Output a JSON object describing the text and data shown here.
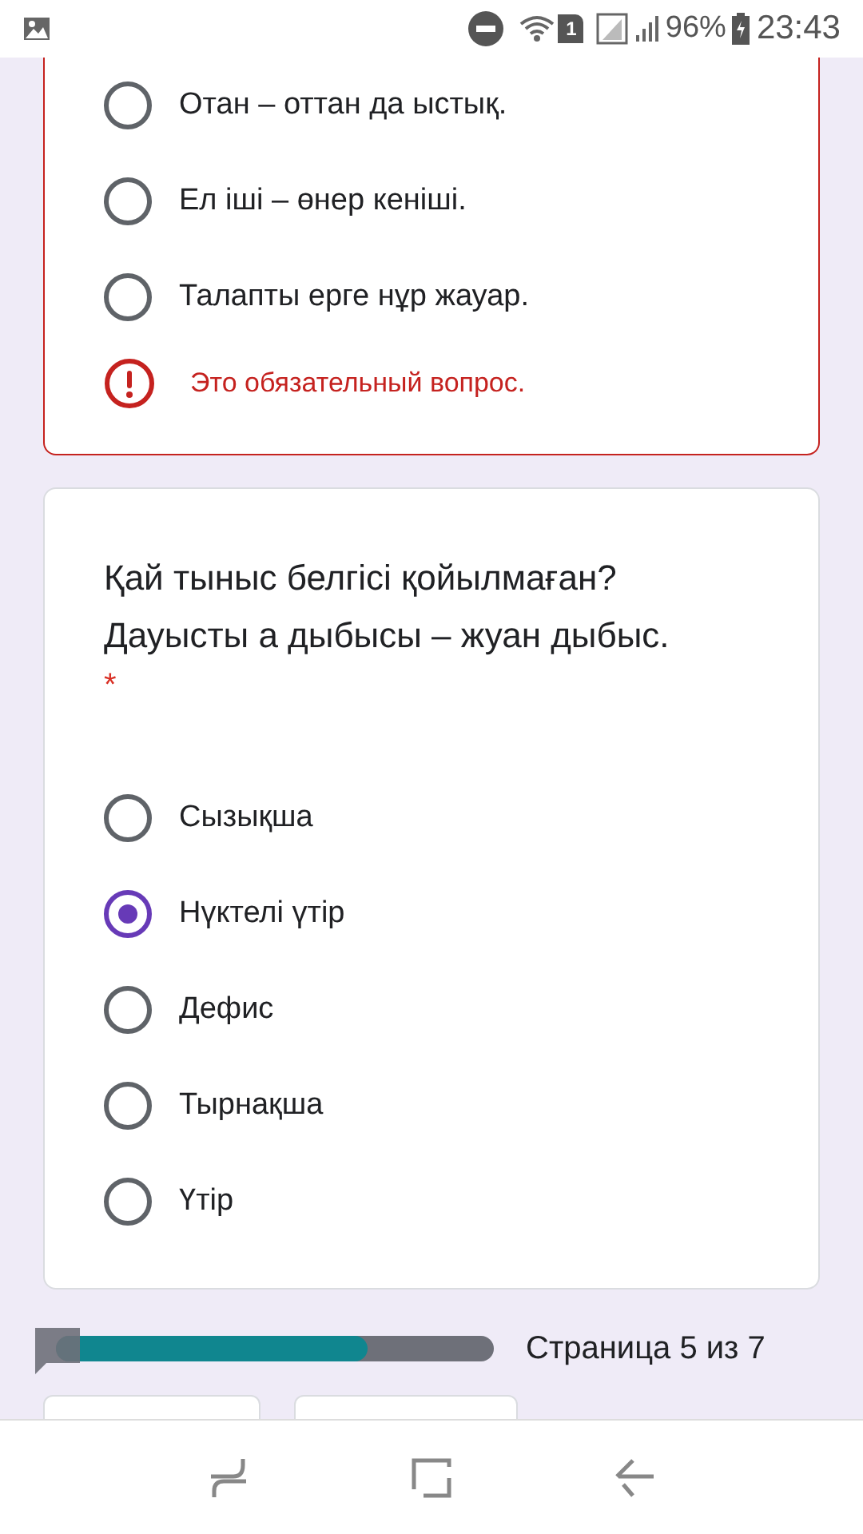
{
  "status_bar": {
    "sim_slot": "1",
    "battery": "96%",
    "time": "23:43"
  },
  "previous_question": {
    "options": [
      {
        "label": "Отан – оттан да ыстық.",
        "selected": false
      },
      {
        "label": "Ел іші – өнер кеніші.",
        "selected": false
      },
      {
        "label": "Талапты ерге нұр жауар.",
        "selected": false
      }
    ],
    "error": "Это обязательный вопрос."
  },
  "question": {
    "title": "Қай тыныс белгісі қойылмаған? Дауысты а дыбысы – жуан дыбыс.",
    "required_mark": "*",
    "options": [
      {
        "label": "Сызықша",
        "selected": false
      },
      {
        "label": "Нүктелі үтір",
        "selected": true
      },
      {
        "label": "Дефис",
        "selected": false
      },
      {
        "label": "Тырнақша",
        "selected": false
      },
      {
        "label": "Үтір",
        "selected": false
      }
    ]
  },
  "progress": {
    "level": 0.71,
    "label": "Страница 5 из 7"
  }
}
